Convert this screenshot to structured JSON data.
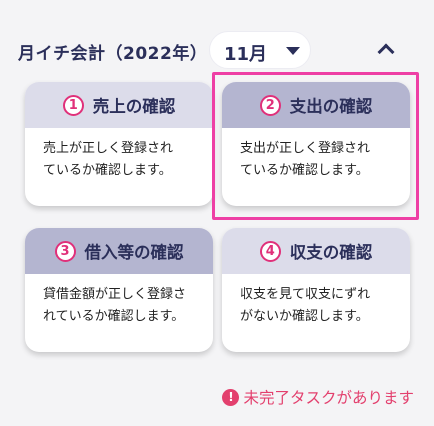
{
  "header": {
    "title": "月イチ会計（2022年）",
    "month": "11月"
  },
  "cards": [
    {
      "number": "1",
      "title": "売上の確認",
      "description_line1": "売上が正しく登録され",
      "description_line2": "ているか確認します。"
    },
    {
      "number": "2",
      "title": "支出の確認",
      "description_line1": "支出が正しく登録され",
      "description_line2": "ているか確認します。"
    },
    {
      "number": "3",
      "title": "借入等の確認",
      "description_line1": "貸借金額が正しく登録さ",
      "description_line2": "れているか確認します。"
    },
    {
      "number": "4",
      "title": "収支の確認",
      "description_line1": "収支を見て収支にずれ",
      "description_line2": "がないか確認します。"
    }
  ],
  "warning": {
    "icon": "exclamation-icon",
    "text": "未完了タスクがあります"
  },
  "colors": {
    "accent_pink": "#e0307a",
    "header_navy": "#2b2f5a",
    "card_head_light": "#dcdcea",
    "card_head_dark": "#b4b5d0",
    "highlight": "#ee3fa5"
  }
}
